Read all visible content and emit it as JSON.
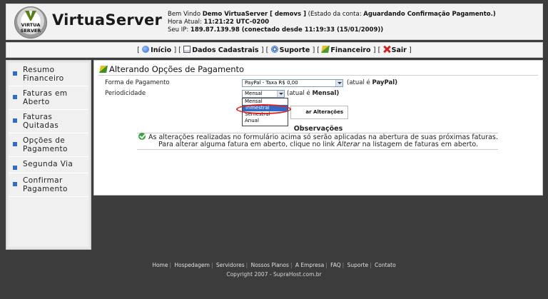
{
  "header": {
    "logo_text": "VirtuaServer",
    "logo_badge_line1": "VIRTUA",
    "logo_badge_line2": "SERVER",
    "welcome_prefix": "Bem Vindo",
    "user_name": "Demo VirtuaServer [ demovs ]",
    "account_status_prefix": "(Estado da conta:",
    "account_status": "Aguardando Confirmação Pagamento.)",
    "time_label": "Hora Atual:",
    "time_value": "11:21:22 UTC-0200",
    "ip_label": "Seu IP:",
    "ip_value": "189.87.139.98 (conectado desde 11:19:33 (15/01/2009))"
  },
  "topnav": {
    "items": [
      {
        "label": "Início",
        "icon": "home-icon"
      },
      {
        "label": "Dados Cadastrais",
        "icon": "document-icon"
      },
      {
        "label": "Suporte",
        "icon": "support-icon"
      },
      {
        "label": "Financeiro",
        "icon": "money-icon"
      },
      {
        "label": "Sair",
        "icon": "exit-icon"
      }
    ]
  },
  "sidebar": {
    "items": [
      {
        "label": "Resumo Financeiro"
      },
      {
        "label": "Faturas em Aberto"
      },
      {
        "label": "Faturas Quitadas"
      },
      {
        "label": "Opções de Pagamento"
      },
      {
        "label": "Segunda Via"
      },
      {
        "label": "Confirmar Pagamento"
      }
    ]
  },
  "main": {
    "title": "Alterando Opções de Pagamento",
    "payment_form_label": "Forma de Pagamento",
    "payment_form_value": "PayPal - Taxa R$ 0,00",
    "payment_form_current_prefix": "(atual é",
    "payment_form_current": "PayPal)",
    "periodicity_label": "Periodicidade",
    "periodicity_value": "Mensal",
    "periodicity_current_prefix": "(atual é",
    "periodicity_current": "Mensal)",
    "periodicity_options": [
      "Mensal",
      "Trimestral",
      "Semestral",
      "Anual"
    ],
    "periodicity_highlighted": "Trimestral",
    "save_button_visible": "ar Alterações",
    "observations_title": "Observações",
    "observation_line1": "As alterações realizadas no formulário acima só serão aplicadas na abertura de suas próximas faturas.",
    "observation_line2_a": "Para alterar alguma fatura em aberto, clique no link",
    "observation_line2_link": "Alterar",
    "observation_line2_b": "na listagem de faturas em aberto."
  },
  "footer": {
    "links": [
      "Home",
      "Hospedagem",
      "Servidores",
      "Nossos Planos",
      "A Empresa",
      "FAQ",
      "Suporte",
      "Contato"
    ],
    "copyright": "Copyright 2007 - SupraHost.com.br"
  },
  "colors": {
    "page_bg": "#3c3c3c",
    "sidebar_bullet": "#2d6ec4",
    "highlight": "#316ac5",
    "annotation_ring": "#d8262c"
  }
}
